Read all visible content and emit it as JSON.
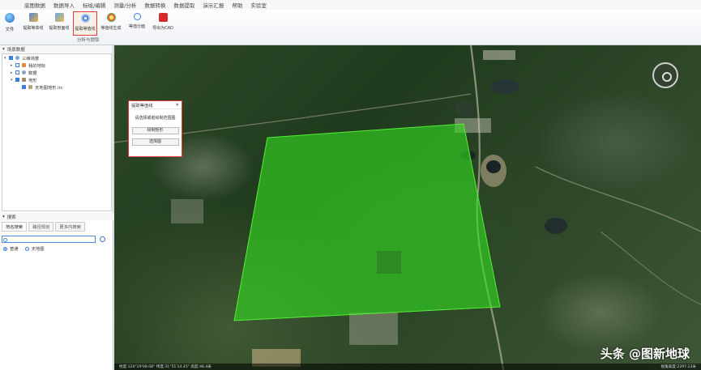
{
  "menu": [
    "底图数据",
    "数据导入",
    "标绘/编辑",
    "测量/分析",
    "数据转换",
    "数据提取",
    "演示汇报",
    "帮助",
    "实验室"
  ],
  "ribbon": {
    "file_label": "文件",
    "tools": [
      {
        "label": "提取等高线",
        "icon": "contour-icon"
      },
      {
        "label": "提取剖面线",
        "icon": "profile-icon"
      },
      {
        "label": "提取等值线",
        "icon": "isoline-icon"
      },
      {
        "label": "等值线生成",
        "icon": "isoline-generate-icon"
      },
      {
        "label": "等值分面",
        "icon": "scissors-icon"
      },
      {
        "label": "导出为CAD",
        "icon": "cad-export-icon"
      }
    ],
    "group_label": "分析与提取",
    "active_tool": "提取等值线"
  },
  "left_panel": {
    "layers_title": "场景数据",
    "tree": [
      {
        "label": "三维场景",
        "level": 0,
        "checked": true
      },
      {
        "label": "我的地标",
        "level": 1,
        "checked": false
      },
      {
        "label": "数据",
        "level": 1,
        "checked": false
      },
      {
        "label": "地形",
        "level": 1,
        "checked": true
      },
      {
        "label": "天地图地形.lrc",
        "level": 2,
        "checked": true
      }
    ],
    "search_title": "搜索",
    "search_tabs": [
      "地名搜索",
      "路径规划",
      "更多内搜索"
    ],
    "search_value": "",
    "radio_options": [
      {
        "label": "普通",
        "selected": true
      },
      {
        "label": "天地图",
        "selected": false
      }
    ]
  },
  "dialog": {
    "title": "提取等值线",
    "close": "✕",
    "prompt": "请选择或者绘制范围图",
    "buttons": [
      "绘制矩形",
      "选择图"
    ]
  },
  "map": {
    "polygon_color": "#33dd22",
    "status_left": "经度:120°29'08.08\" 纬度:31°51'14.45\" 高度:46.4米",
    "status_right": "视角高度:2297.23米",
    "watermark": "头条 @图新地球"
  }
}
